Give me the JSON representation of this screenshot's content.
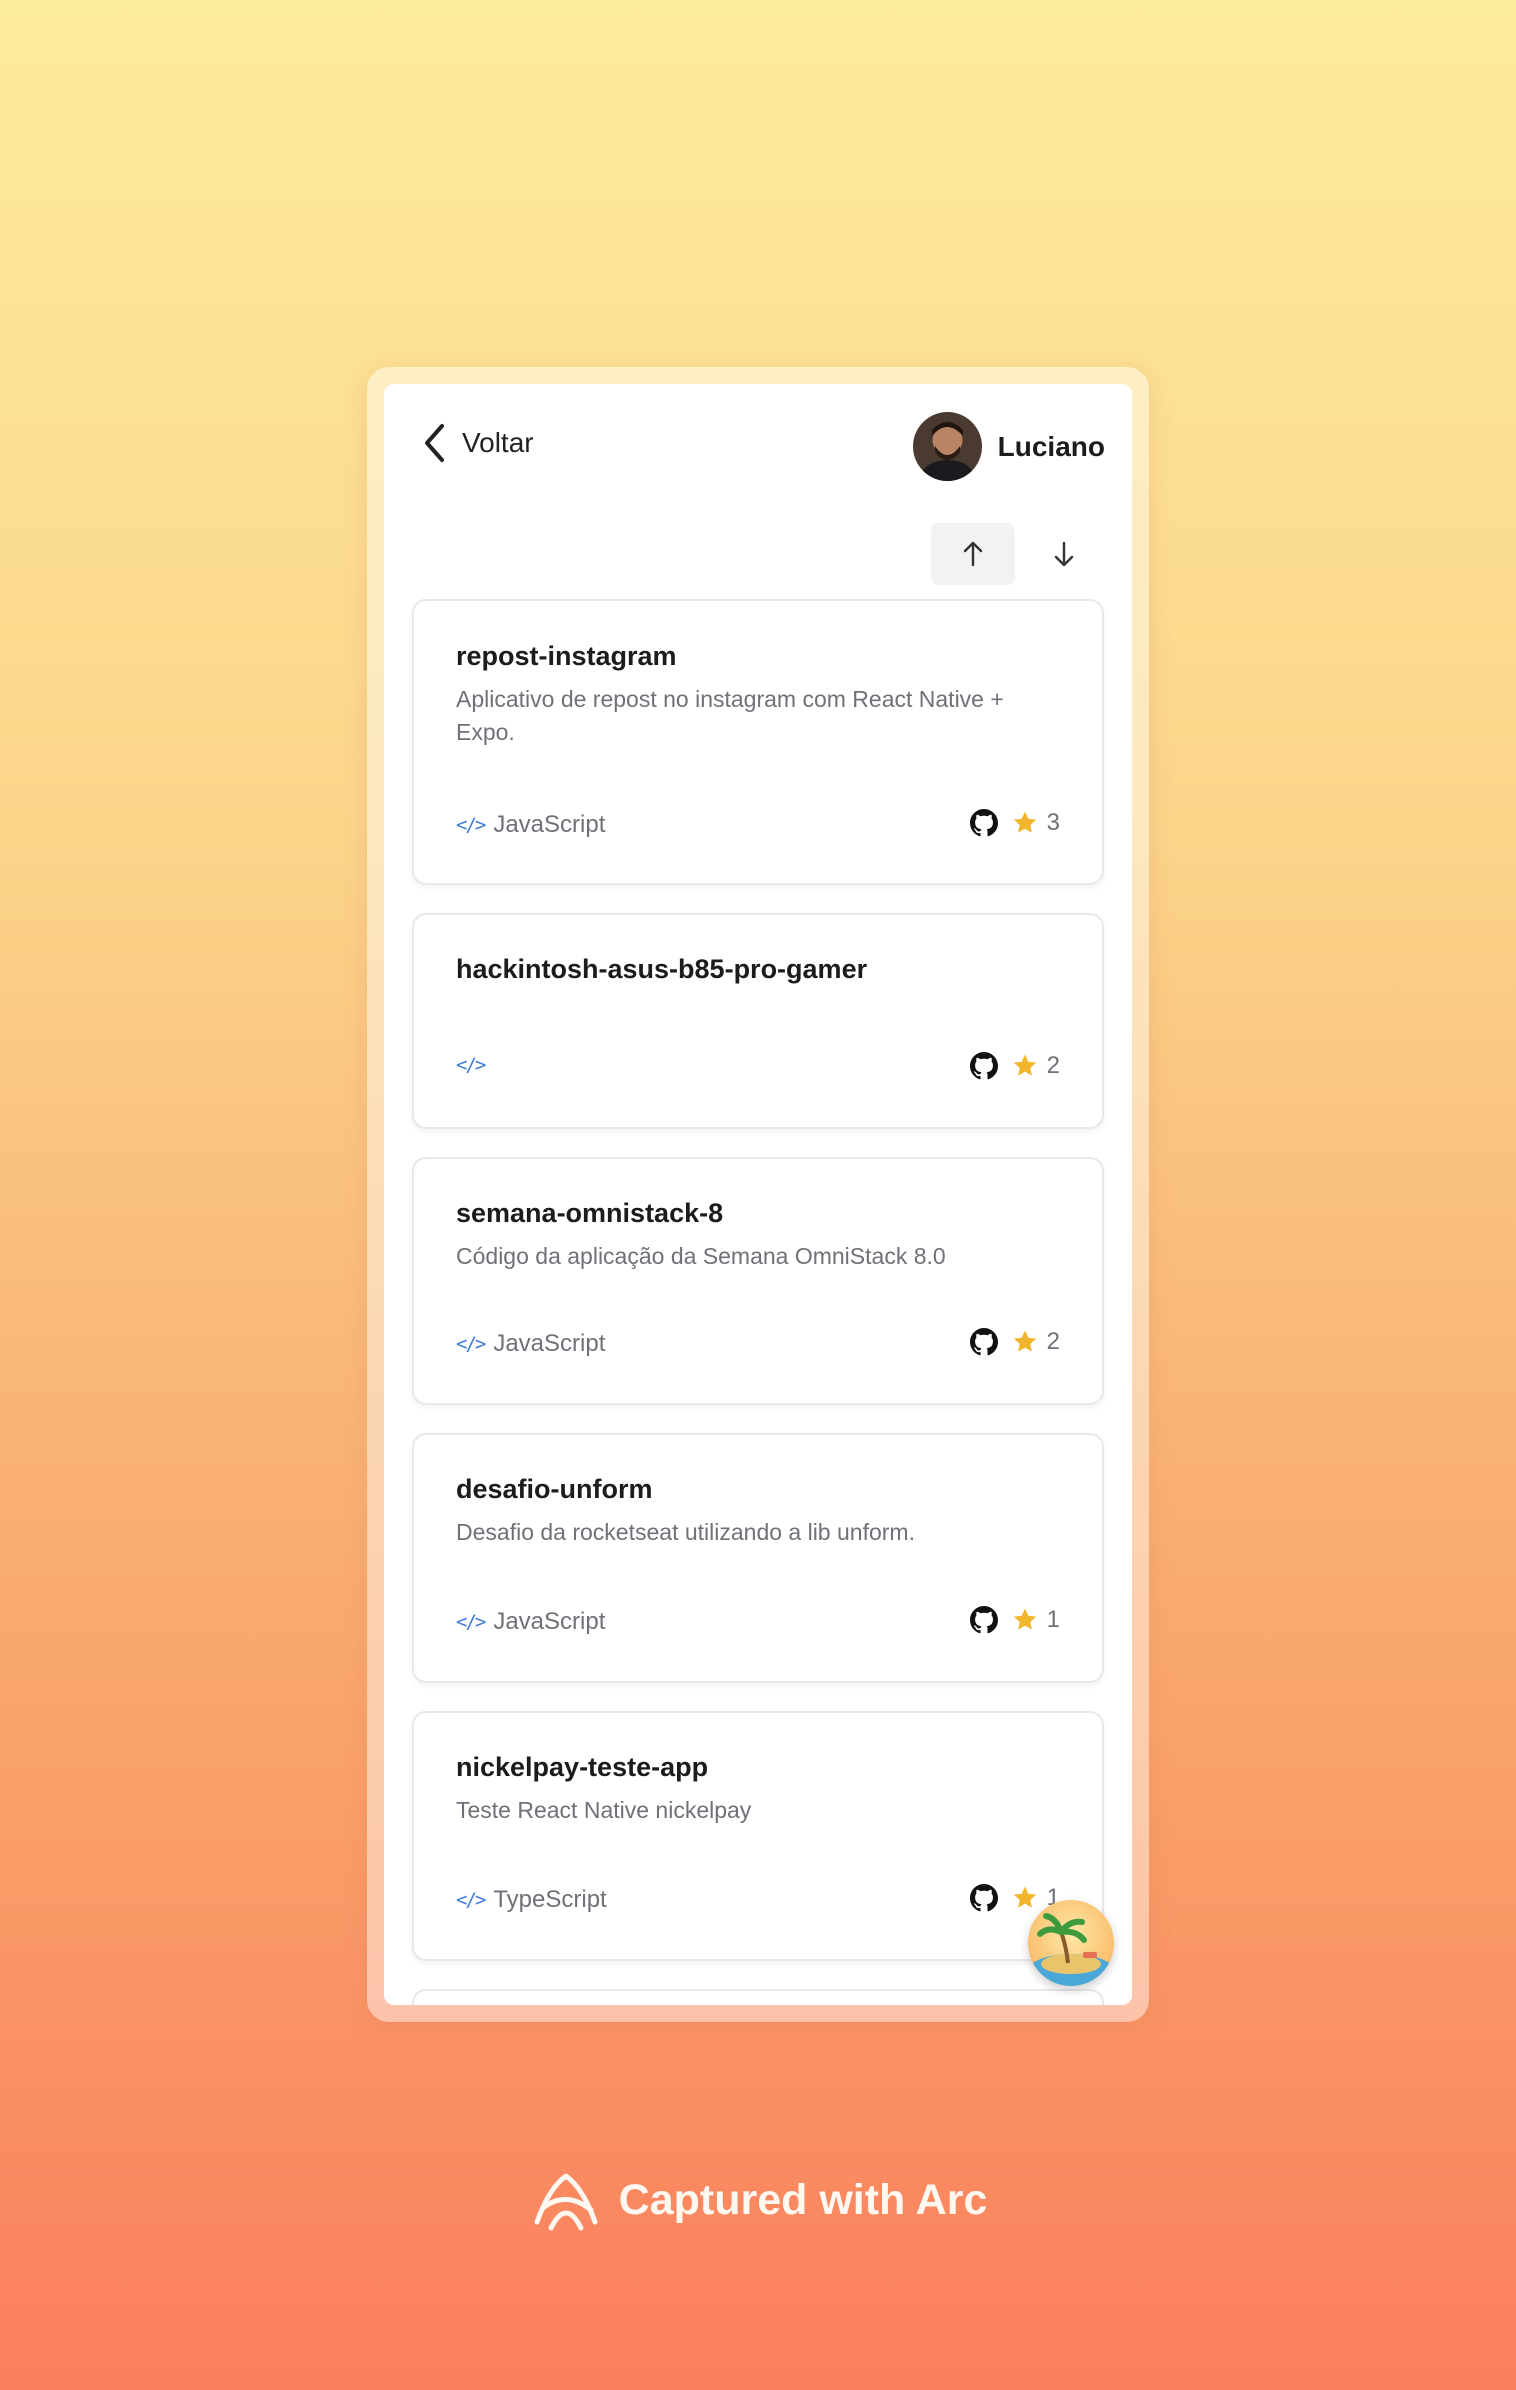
{
  "header": {
    "back_label": "Voltar",
    "user_name": "Luciano"
  },
  "sort": {
    "up_icon": "arrow-up-icon",
    "down_icon": "arrow-down-icon",
    "active": "up"
  },
  "repos": [
    {
      "name": "repost-instagram",
      "description": "Aplicativo de repost no instagram com React Native + Expo.",
      "language": "JavaScript",
      "stars": "3"
    },
    {
      "name": "hackintosh-asus-b85-pro-gamer",
      "description": "",
      "language": "",
      "stars": "2"
    },
    {
      "name": "semana-omnistack-8",
      "description": "Código da aplicação da Semana OmniStack 8.0",
      "language": "JavaScript",
      "stars": "2"
    },
    {
      "name": "desafio-unform",
      "description": "Desafio da rocketseat utilizando a lib unform.",
      "language": "JavaScript",
      "stars": "1"
    },
    {
      "name": "nickelpay-teste-app",
      "description": "Teste React Native nickelpay",
      "language": "TypeScript",
      "stars": "1"
    }
  ],
  "watermark": {
    "text": "Captured with Arc"
  },
  "colors": {
    "accent_code": "#3f7bd9",
    "star": "#f2b52e",
    "text_dark": "#1c1c1e",
    "text_muted": "#6e7177"
  }
}
